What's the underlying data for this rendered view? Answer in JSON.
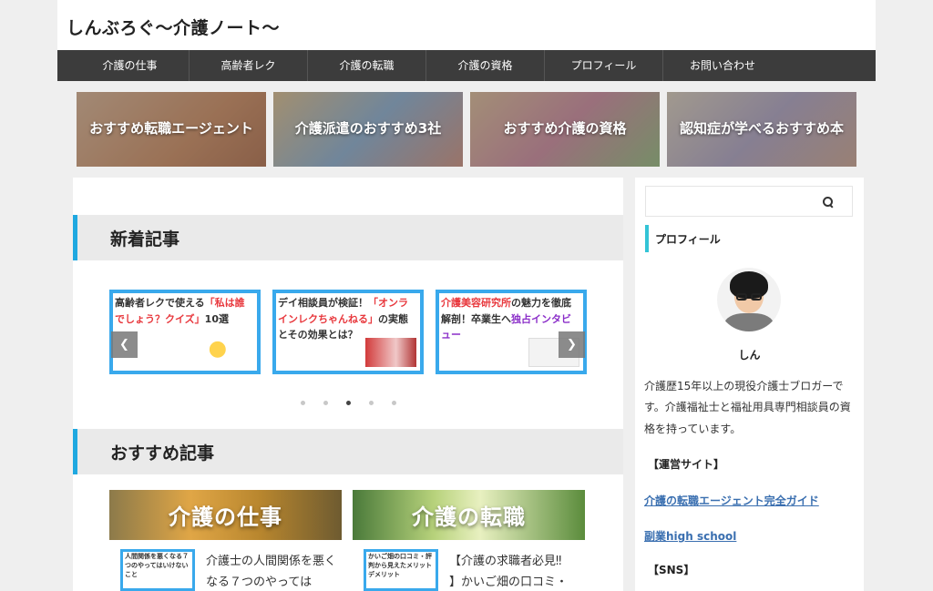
{
  "site": {
    "title": "しんぶろぐ〜介護ノート〜"
  },
  "nav": {
    "items": [
      "介護の仕事",
      "高齢者レク",
      "介護の転職",
      "介護の資格",
      "プロフィール",
      "お問い合わせ"
    ]
  },
  "banners": [
    "おすすめ転職エージェント",
    "介護派遣のおすすめ3社",
    "おすすめ介護の資格",
    "認知症が学べるおすすめ本"
  ],
  "sections": {
    "new": "新着記事",
    "recommended": "おすすめ記事"
  },
  "carousel": {
    "cards": [
      {
        "pre": "高齢者レクで使える",
        "hl": "「私は誰でしょう？クイズ」",
        "post": "10選",
        "thumb": ""
      },
      {
        "pre": "デイ相談員が検証！",
        "hl": "「オンラインレクちゃんねる」",
        "post": "の実態とその効果とは？",
        "thumb": ""
      },
      {
        "pre": "",
        "hl": "介護美容研究所",
        "post": "の魅力を徹底解剖！卒業生へ",
        "hl2": "独占インタビュー",
        "thumb": ""
      }
    ],
    "prev_glyph": "❮",
    "next_glyph": "❯",
    "dots": 5,
    "active_dot": 2
  },
  "recommended": [
    {
      "category": "介護の仕事",
      "thumb_text": "人間関係を悪くなる７つのやってはいけないこと",
      "text": "介護士の人間関係を悪くなる７つのやっては",
      "badge": ""
    },
    {
      "category": "介護の転職",
      "thumb_text": "かいご畑の口コミ・評判から見えたメリットデメリット",
      "text": "】かいご畑の口コミ・",
      "badge": "【介護の求職者必見‼"
    }
  ],
  "sidebar": {
    "search_placeholder": "",
    "profile_heading": "プロフィール",
    "name": "しん",
    "bio": "介護歴15年以上の現役介護士ブロガーです。介護福祉士と福祉用具専門相談員の資格を持っています。",
    "sites_label": "【運営サイト】",
    "links": [
      "介護の転職エージェント完全ガイド",
      "副業high school"
    ],
    "sns_label": "【SNS】"
  }
}
